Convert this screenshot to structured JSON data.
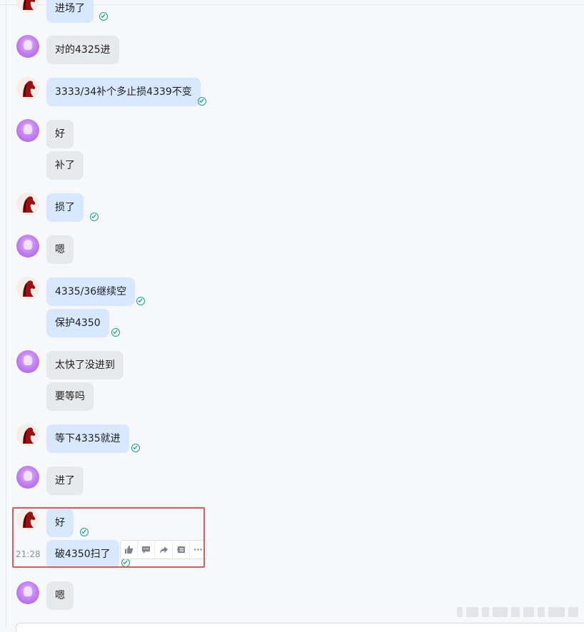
{
  "chat": {
    "messages": [
      {
        "text": "进场了"
      },
      {
        "text": "对的4325进"
      },
      {
        "text": "3333/34补个多止损4339不变"
      },
      {
        "text": "好"
      },
      {
        "text": "补了"
      },
      {
        "text": "损了"
      },
      {
        "text": "嗯"
      },
      {
        "text": "4335/36继续空"
      },
      {
        "text": "保护4350"
      },
      {
        "text": "太快了没进到"
      },
      {
        "text": "要等吗"
      },
      {
        "text": "等下4335就进"
      },
      {
        "text": "进了"
      },
      {
        "text": "好"
      },
      {
        "text": "破4350扫了"
      },
      {
        "text": "嗯"
      }
    ],
    "hover_timestamp": "21:28",
    "toolbar_icons": [
      "thumbs-up-icon",
      "comment-icon",
      "forward-icon",
      "quote-icon",
      "more-icon"
    ],
    "colors": {
      "sent_bubble": "#d7e8ff",
      "received_bubble": "#e8e9eb",
      "check": "#1aa28a",
      "highlight": "#e05a5a"
    }
  }
}
